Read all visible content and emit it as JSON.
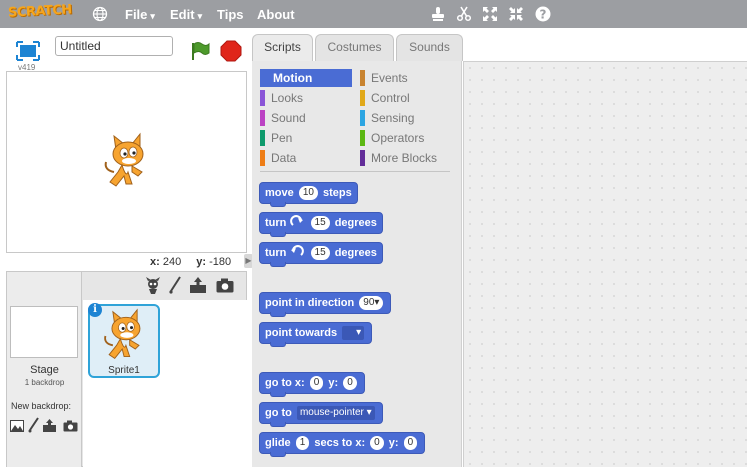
{
  "menubar": {
    "logo": "SCRATCH",
    "menus": [
      {
        "label": "File",
        "has_caret": true
      },
      {
        "label": "Edit",
        "has_caret": true
      },
      {
        "label": "Tips",
        "has_caret": false
      },
      {
        "label": "About",
        "has_caret": false
      }
    ],
    "caret": "▾",
    "tools": [
      "duplicate-stamp-icon",
      "cut-scissors-icon",
      "grow-icon",
      "shrink-icon",
      "help-icon"
    ]
  },
  "stage": {
    "version": "v419",
    "title_value": "Untitled",
    "coords": {
      "x_label": "x:",
      "x_value": "240",
      "y_label": "y:",
      "y_value": "-180"
    }
  },
  "sprite_library": {
    "stage_label": "Stage",
    "backdrop_count": "1 backdrop",
    "new_backdrop_label": "New backdrop:",
    "sprite_name": "Sprite1",
    "info_glyph": "i"
  },
  "tabs": [
    {
      "label": "Scripts",
      "active": true
    },
    {
      "label": "Costumes",
      "active": false
    },
    {
      "label": "Sounds",
      "active": false
    }
  ],
  "categories": [
    {
      "label": "Motion",
      "color": "#4a6cd4",
      "selected": true
    },
    {
      "label": "Looks",
      "color": "#8a55d7"
    },
    {
      "label": "Sound",
      "color": "#bb42c3"
    },
    {
      "label": "Pen",
      "color": "#0e9a6c"
    },
    {
      "label": "Data",
      "color": "#ee7d16"
    },
    {
      "label": "Events",
      "color": "#c88330"
    },
    {
      "label": "Control",
      "color": "#e1a91a"
    },
    {
      "label": "Sensing",
      "color": "#2ca5e2"
    },
    {
      "label": "Operators",
      "color": "#5cb712"
    },
    {
      "label": "More Blocks",
      "color": "#632d99"
    }
  ],
  "blocks": {
    "move": {
      "text": "move",
      "value": "10",
      "suffix": "steps"
    },
    "turn_right": {
      "text": "turn",
      "value": "15",
      "suffix": "degrees"
    },
    "turn_left": {
      "text": "turn",
      "value": "15",
      "suffix": "degrees"
    },
    "point_direction": {
      "text": "point in direction",
      "value": "90▾"
    },
    "point_towards": {
      "text": "point towards",
      "value": "▾"
    },
    "goto_xy": {
      "text": "go to x:",
      "x": "0",
      "ylabel": "y:",
      "y": "0"
    },
    "goto": {
      "text": "go to",
      "value": "mouse-pointer ▾"
    },
    "glide": {
      "text": "glide",
      "secs": "1",
      "mid": "secs to x:",
      "x": "0",
      "ylabel": "y:",
      "y": "0"
    }
  },
  "colors": {
    "menubar": "#9c9ea2",
    "logo": "#f6a51c",
    "motion": "#4a6cd4",
    "selection": "#2fa3d8",
    "green_flag": "#4d9a2b",
    "stop": "#e0251a"
  }
}
